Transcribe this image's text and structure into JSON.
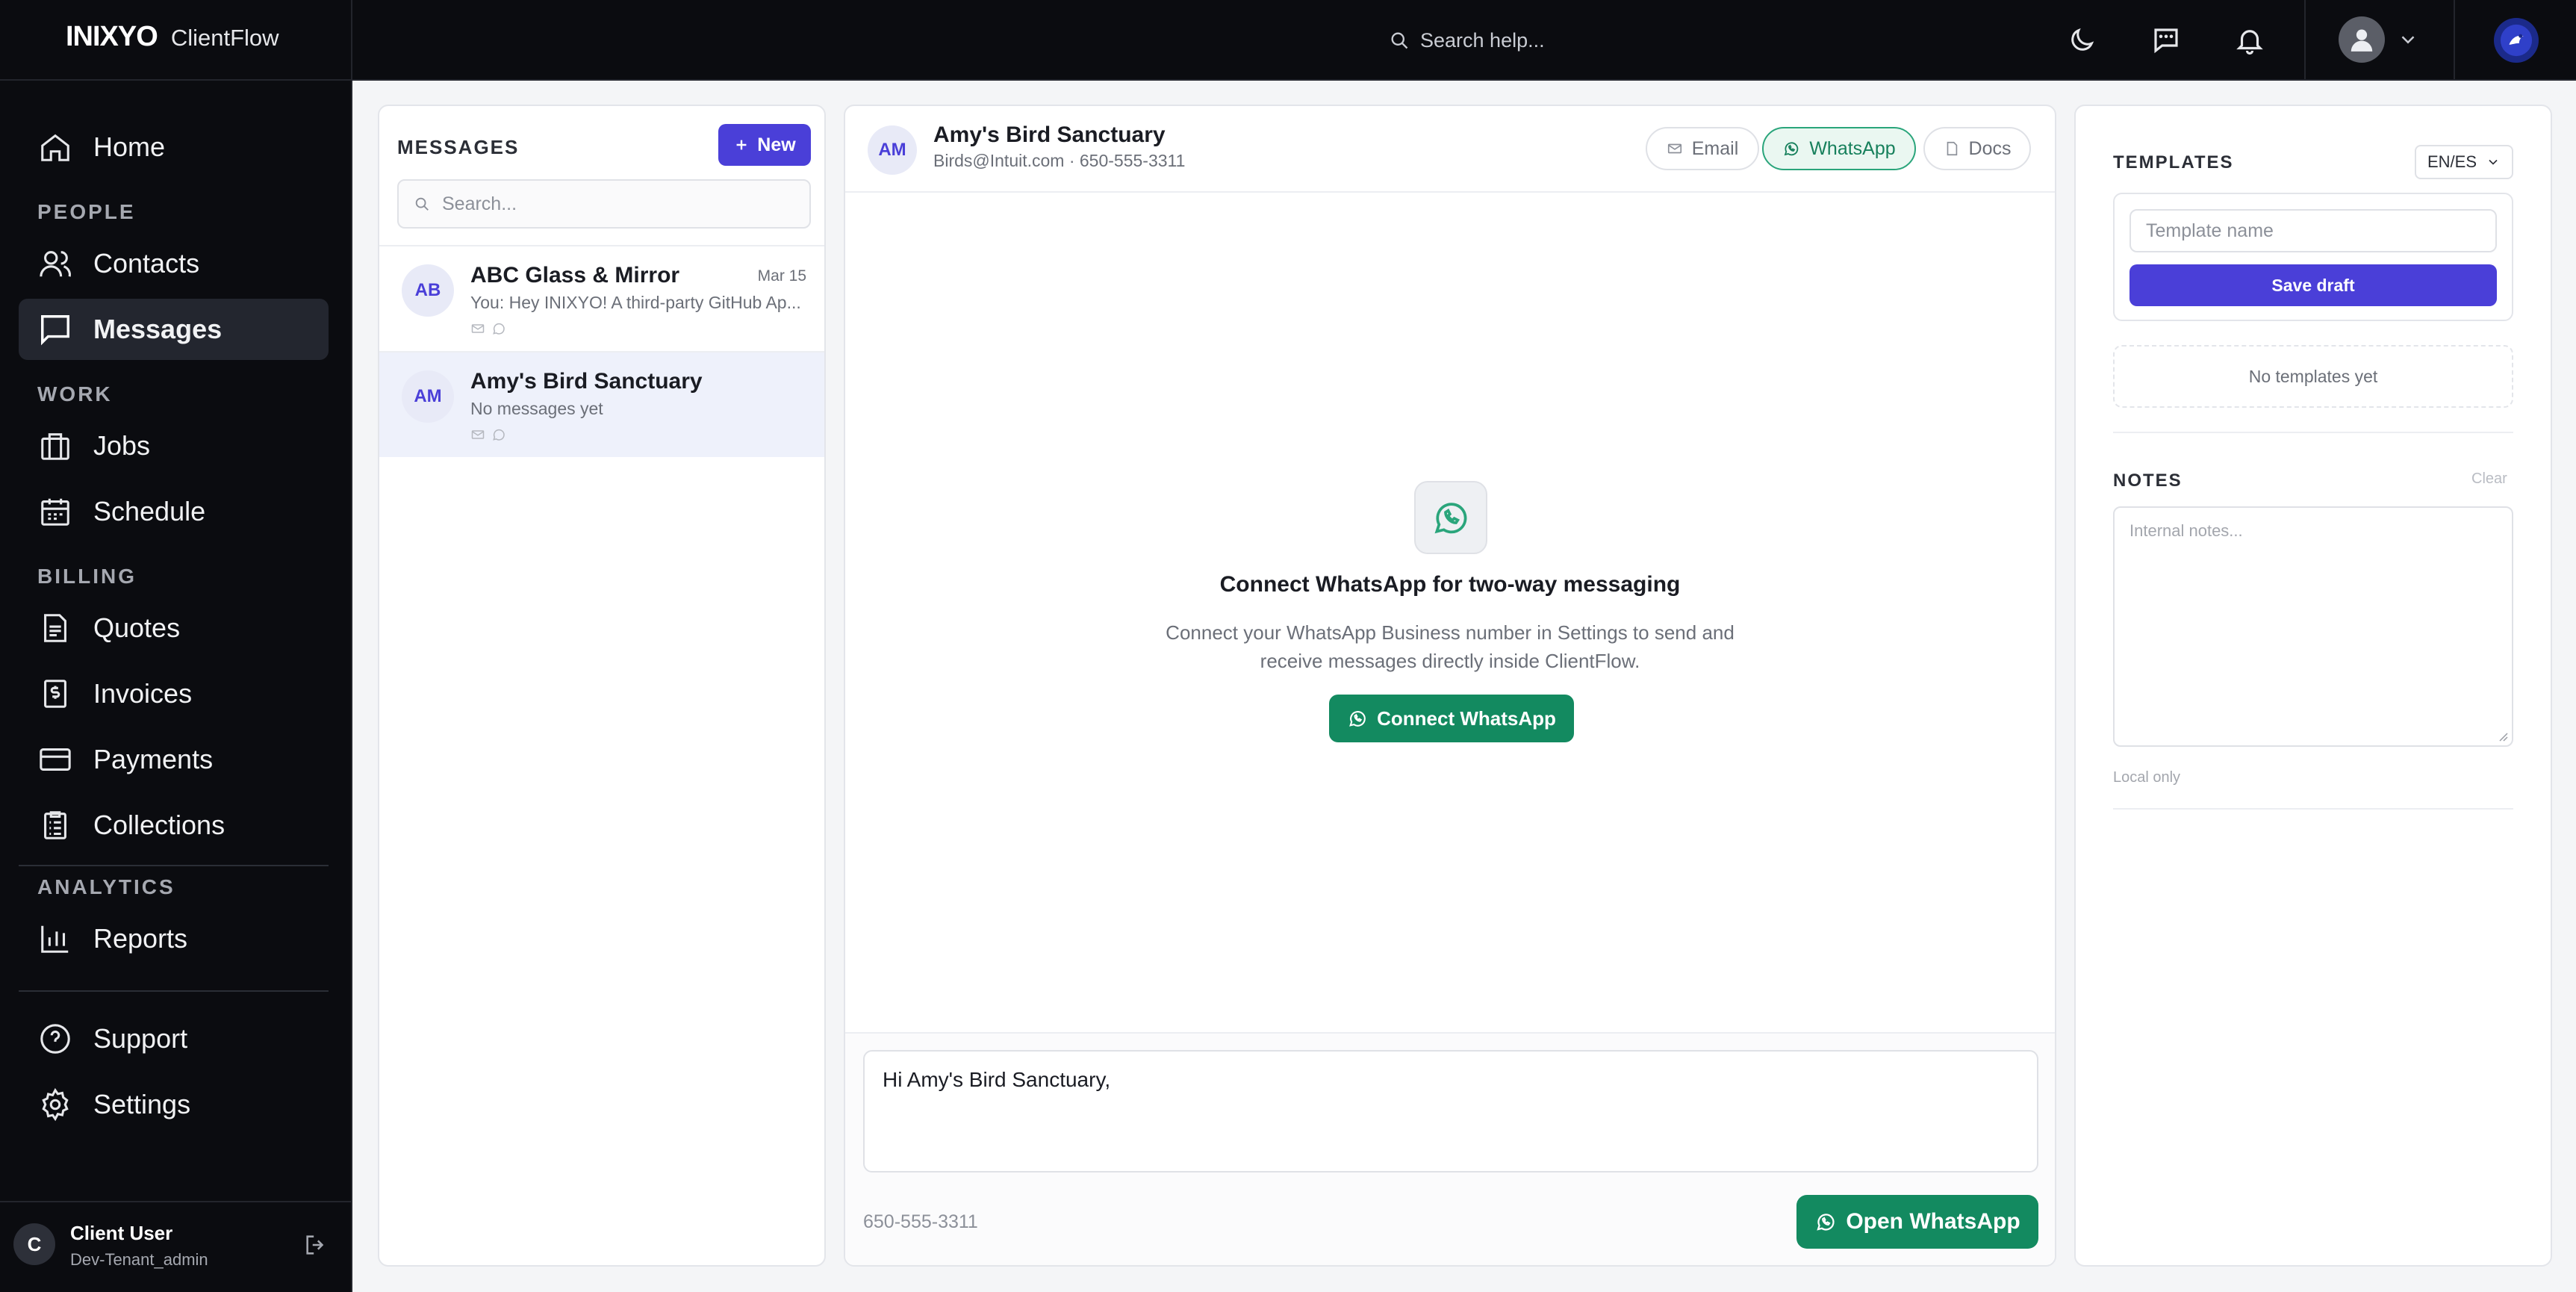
{
  "topbar": {
    "brand_logo": "INIXYO",
    "brand_app": "ClientFlow",
    "search_placeholder": "Search help...",
    "icons": [
      "moon-icon",
      "chat-icon",
      "bell-icon",
      "user-avatar-icon",
      "chevron-down-icon",
      "tenant-badge"
    ]
  },
  "sidebar": {
    "sections": {
      "people": "PEOPLE",
      "work": "WORK",
      "billing": "BILLING",
      "analytics": "ANALYTICS"
    },
    "items": {
      "home": "Home",
      "contacts": "Contacts",
      "messages": "Messages",
      "jobs": "Jobs",
      "schedule": "Schedule",
      "quotes": "Quotes",
      "invoices": "Invoices",
      "payments": "Payments",
      "collections": "Collections",
      "reports": "Reports",
      "support": "Support",
      "settings": "Settings"
    },
    "active_item": "messages",
    "user": {
      "initial": "C",
      "name": "Client User",
      "tenant": "Dev-Tenant_admin"
    }
  },
  "messages_panel": {
    "title": "MESSAGES",
    "new_label": "New",
    "search_placeholder": "Search...",
    "conversations": [
      {
        "initials": "AB",
        "name": "ABC Glass & Mirror",
        "date": "Mar 15",
        "preview": "You: Hey INIXYO! A third-party GitHub Ap..."
      },
      {
        "initials": "AM",
        "name": "Amy's Bird Sanctuary",
        "date": "",
        "preview": "No messages yet"
      }
    ]
  },
  "chat": {
    "contact_initials": "AM",
    "contact_name": "Amy's Bird Sanctuary",
    "contact_sub": "Birds@Intuit.com · 650-555-3311",
    "channels": {
      "email": "Email",
      "whatsapp": "WhatsApp",
      "docs": "Docs"
    },
    "active_channel": "whatsapp",
    "empty_title": "Connect WhatsApp for two-way messaging",
    "empty_desc": "Connect your WhatsApp Business number in Settings to send and receive messages directly inside ClientFlow.",
    "connect_label": "Connect WhatsApp",
    "composer_text": "Hi Amy's Bird Sanctuary,",
    "phone": "650-555-3311",
    "open_label": "Open WhatsApp"
  },
  "side": {
    "templates_label": "TEMPLATES",
    "lang_value": "EN/ES",
    "template_name_placeholder": "Template name",
    "save_draft_label": "Save draft",
    "no_templates": "No templates yet",
    "notes_label": "NOTES",
    "clear_label": "Clear",
    "notes_placeholder": "Internal notes...",
    "local_only": "Local only"
  },
  "colors": {
    "primary": "#4a3fd8",
    "whatsapp_green": "#138a60",
    "sidebar_bg": "#0b0c10"
  }
}
